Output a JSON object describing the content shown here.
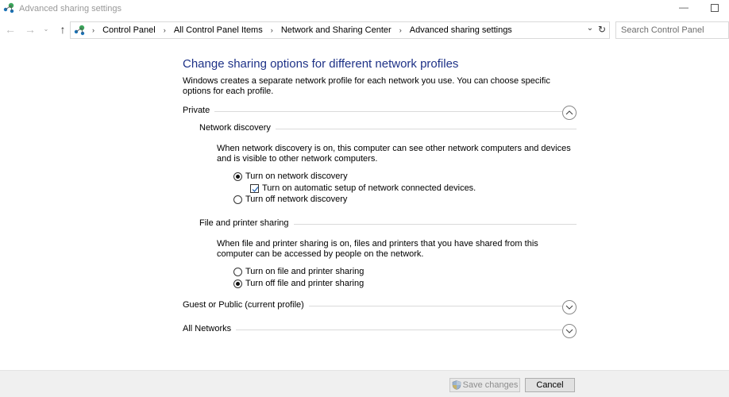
{
  "window": {
    "title": "Advanced sharing settings",
    "minimize_glyph": "—"
  },
  "nav": {
    "back_glyph": "←",
    "forward_glyph": "→",
    "recent_glyph": "⌄",
    "up_glyph": "↑",
    "breadcrumbs": [
      "Control Panel",
      "All Control Panel Items",
      "Network and Sharing Center",
      "Advanced sharing settings"
    ],
    "separator": "›",
    "dropdown_glyph": "⌄",
    "refresh_glyph": "↻"
  },
  "search": {
    "placeholder": "Search Control Panel"
  },
  "main": {
    "heading": "Change sharing options for different network profiles",
    "intro": "Windows creates a separate network profile for each network you use. You can choose specific options for each profile."
  },
  "private": {
    "label": "Private",
    "expanded": true,
    "network_discovery": {
      "label": "Network discovery",
      "description": "When network discovery is on, this computer can see other network computers and devices and is visible to other network computers.",
      "turn_on": "Turn on network discovery",
      "auto_setup": "Turn on automatic setup of network connected devices.",
      "turn_off": "Turn off network discovery",
      "selected": "on",
      "auto_setup_checked": true
    },
    "file_printer_sharing": {
      "label": "File and printer sharing",
      "description": "When file and printer sharing is on, files and printers that you have shared from this computer can be accessed by people on the network.",
      "turn_on": "Turn on file and printer sharing",
      "turn_off": "Turn off file and printer sharing",
      "selected": "off"
    }
  },
  "guest_public": {
    "label": "Guest or Public (current profile)",
    "expanded": false
  },
  "all_networks": {
    "label": "All Networks",
    "expanded": false
  },
  "footer": {
    "save_label": "Save changes",
    "cancel_label": "Cancel"
  },
  "icons": {
    "app": "network-sharing-icon",
    "expand": "chevron-down-icon",
    "collapse": "chevron-up-icon",
    "shield": "uac-shield-icon"
  },
  "colors": {
    "heading": "#1e3287",
    "footer_bg": "#f0f0f0",
    "icon_green": "#3aa55a",
    "icon_blue": "#1a73b8"
  }
}
